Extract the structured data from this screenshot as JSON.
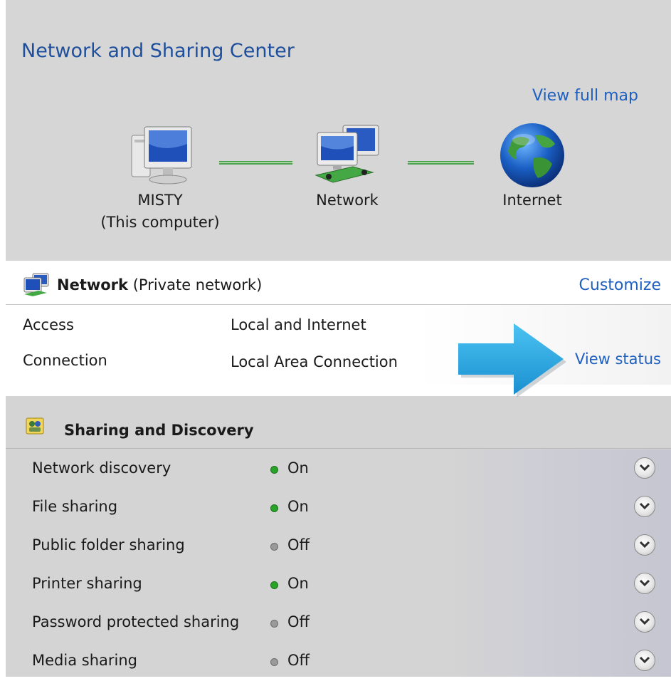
{
  "header": {
    "title": "Network and Sharing Center",
    "view_full_map": "View full map"
  },
  "map": {
    "computer": {
      "name": "MISTY",
      "subtitle": "(This computer)",
      "icon": "computer-icon"
    },
    "network": {
      "name": "Network",
      "icon": "network-icon"
    },
    "internet": {
      "name": "Internet",
      "icon": "globe-icon"
    }
  },
  "network_panel": {
    "name_bold": "Network",
    "name_type": "(Private network)",
    "customize": "Customize",
    "rows": [
      {
        "label": "Access",
        "value": "Local and Internet"
      },
      {
        "label": "Connection",
        "value": "Local Area Connection"
      }
    ],
    "view_status": "View status"
  },
  "sharing": {
    "title": "Sharing and Discovery",
    "items": [
      {
        "label": "Network discovery",
        "status": "On"
      },
      {
        "label": "File sharing",
        "status": "On"
      },
      {
        "label": "Public folder sharing",
        "status": "Off"
      },
      {
        "label": "Printer sharing",
        "status": "On"
      },
      {
        "label": "Password protected sharing",
        "status": "Off"
      },
      {
        "label": "Media sharing",
        "status": "Off"
      }
    ]
  },
  "colors": {
    "link": "#1e5fbf",
    "title": "#1e4f9c",
    "status_on": "#28a428",
    "status_off": "#9a9a9a",
    "arrow": "#1ea8e0"
  }
}
